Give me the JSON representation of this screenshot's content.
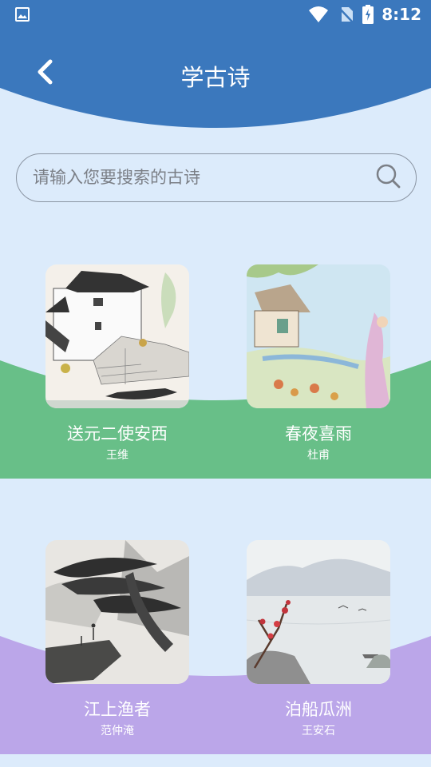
{
  "status": {
    "time": "8:12"
  },
  "header": {
    "title": "学古诗",
    "back_icon": "back-arrow-icon"
  },
  "search": {
    "placeholder": "请输入您要搜索的古诗",
    "value": ""
  },
  "colors": {
    "header": "#3b78bd",
    "band1": "#68bf88",
    "band2": "#bba6e9",
    "background": "#dcebfb"
  },
  "poems": [
    {
      "title": "送元二使安西",
      "author": "王维"
    },
    {
      "title": "春夜喜雨",
      "author": "杜甫"
    },
    {
      "title": "江上渔者",
      "author": "范仲淹"
    },
    {
      "title": "泊船瓜洲",
      "author": "王安石"
    }
  ]
}
